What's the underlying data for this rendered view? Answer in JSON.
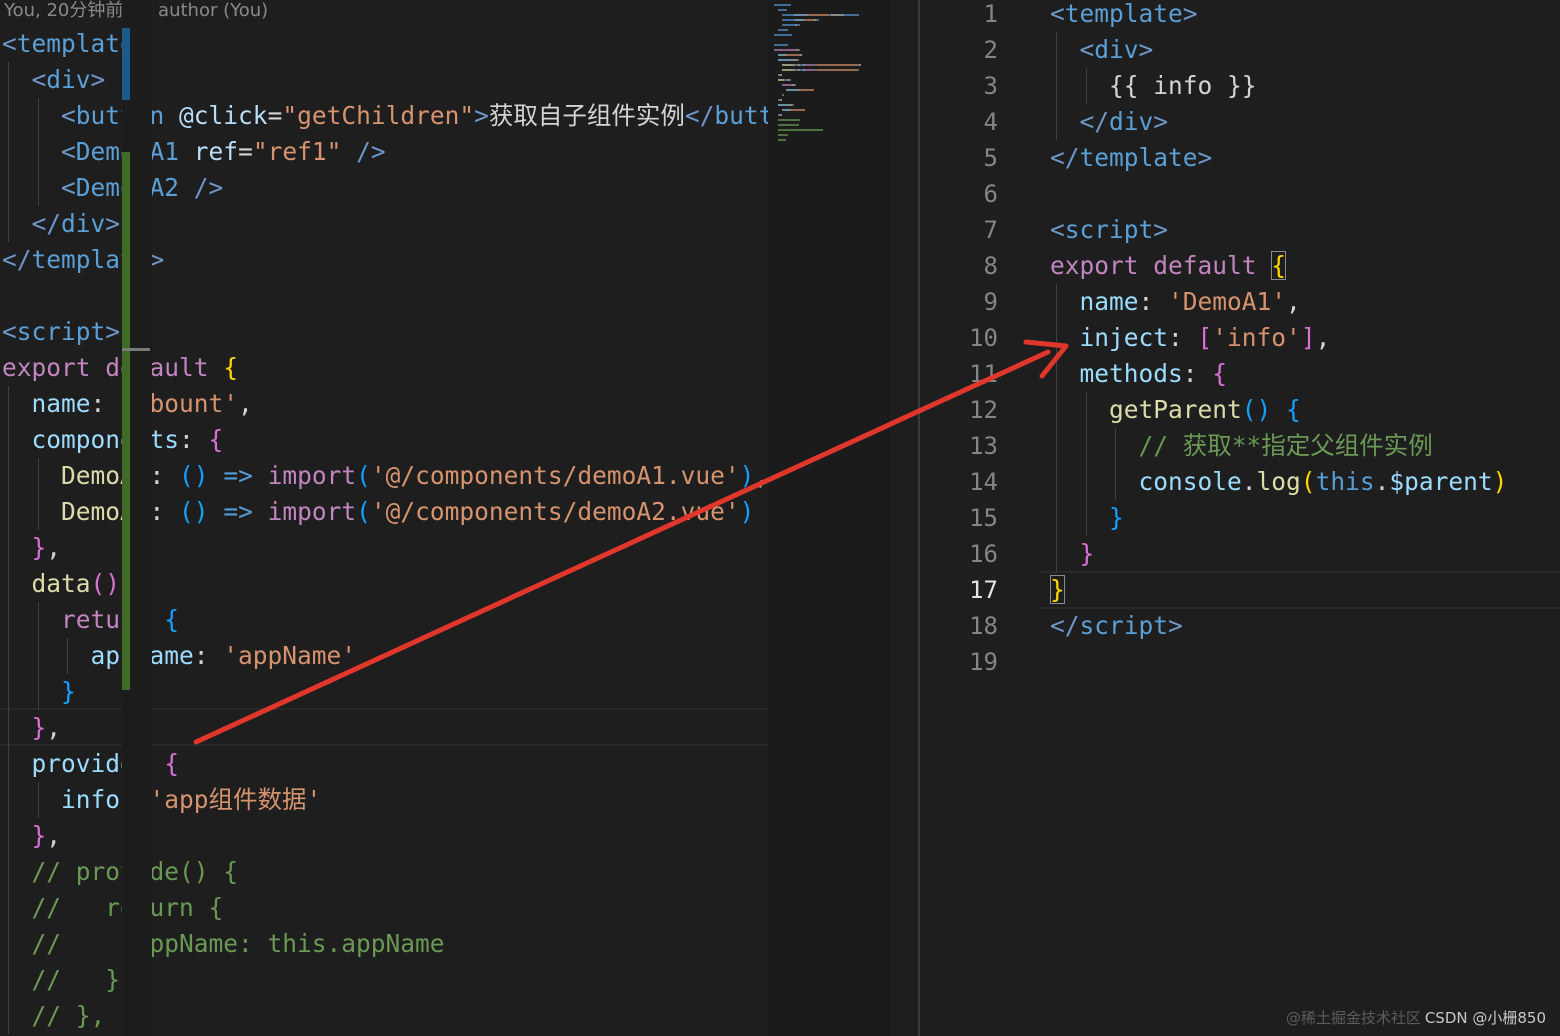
{
  "blame": "You, 20分钟前 | 1 author (You)",
  "left_code": [
    {
      "indent": 0,
      "tokens": [
        [
          "t-tag",
          "<"
        ],
        [
          "t-tagname",
          "template"
        ],
        [
          "t-tag",
          ">"
        ]
      ]
    },
    {
      "indent": 1,
      "tokens": [
        [
          "t-tag",
          "<"
        ],
        [
          "t-tagname",
          "div"
        ],
        [
          "t-tag",
          ">"
        ]
      ]
    },
    {
      "indent": 2,
      "tokens": [
        [
          "t-tag",
          "<"
        ],
        [
          "t-tagname",
          "button"
        ],
        [
          "t-text",
          " "
        ],
        [
          "t-attr",
          "@click"
        ],
        [
          "t-text",
          "="
        ],
        [
          "t-str",
          "\"getChildren\""
        ],
        [
          "t-tag",
          ">"
        ],
        [
          "t-text",
          "获取自子组件实例"
        ],
        [
          "t-tag",
          "</"
        ],
        [
          "t-tagname",
          "button"
        ],
        [
          "t-tag",
          ">"
        ]
      ]
    },
    {
      "indent": 2,
      "tokens": [
        [
          "t-tag",
          "<"
        ],
        [
          "t-tagname",
          "Demo-A1"
        ],
        [
          "t-text",
          " "
        ],
        [
          "t-attr",
          "ref"
        ],
        [
          "t-text",
          "="
        ],
        [
          "t-str",
          "\"ref1\""
        ],
        [
          "t-text",
          " "
        ],
        [
          "t-tag",
          "/>"
        ]
      ]
    },
    {
      "indent": 2,
      "tokens": [
        [
          "t-tag",
          "<"
        ],
        [
          "t-tagname",
          "Demo-A2"
        ],
        [
          "t-text",
          " "
        ],
        [
          "t-tag",
          "/>"
        ]
      ]
    },
    {
      "indent": 1,
      "tokens": [
        [
          "t-tag",
          "</"
        ],
        [
          "t-tagname",
          "div"
        ],
        [
          "t-tag",
          ">"
        ]
      ]
    },
    {
      "indent": 0,
      "tokens": [
        [
          "t-tag",
          "</"
        ],
        [
          "t-tagname",
          "template"
        ],
        [
          "t-tag",
          ">"
        ]
      ]
    },
    {
      "indent": 0,
      "tokens": []
    },
    {
      "indent": 0,
      "tokens": [
        [
          "t-tag",
          "<"
        ],
        [
          "t-tagname",
          "script"
        ],
        [
          "t-tag",
          ">"
        ]
      ]
    },
    {
      "indent": 0,
      "tokens": [
        [
          "t-kw",
          "export default"
        ],
        [
          "t-text",
          " "
        ],
        [
          "t-brace1",
          "{"
        ]
      ]
    },
    {
      "indent": 1,
      "tokens": [
        [
          "t-prop",
          "name"
        ],
        [
          "t-text",
          ": "
        ],
        [
          "t-str",
          "'abount'"
        ],
        [
          "t-text",
          ","
        ]
      ]
    },
    {
      "indent": 1,
      "tokens": [
        [
          "t-prop",
          "components"
        ],
        [
          "t-text",
          ": "
        ],
        [
          "t-brace2",
          "{"
        ]
      ]
    },
    {
      "indent": 2,
      "tokens": [
        [
          "t-fn",
          "DemoA1"
        ],
        [
          "t-text",
          ": "
        ],
        [
          "t-brace3",
          "()"
        ],
        [
          "t-text",
          " "
        ],
        [
          "t-this",
          "=>"
        ],
        [
          "t-text",
          " "
        ],
        [
          "t-kw",
          "import"
        ],
        [
          "t-brace3",
          "("
        ],
        [
          "t-str",
          "'@/components/demoA1.vue'"
        ],
        [
          "t-brace3",
          ")"
        ],
        [
          "t-text",
          ","
        ]
      ]
    },
    {
      "indent": 2,
      "tokens": [
        [
          "t-fn",
          "DemoA2"
        ],
        [
          "t-text",
          ": "
        ],
        [
          "t-brace3",
          "()"
        ],
        [
          "t-text",
          " "
        ],
        [
          "t-this",
          "=>"
        ],
        [
          "t-text",
          " "
        ],
        [
          "t-kw",
          "import"
        ],
        [
          "t-brace3",
          "("
        ],
        [
          "t-str",
          "'@/components/demoA2.vue'"
        ],
        [
          "t-brace3",
          ")"
        ]
      ]
    },
    {
      "indent": 1,
      "tokens": [
        [
          "t-brace2",
          "}"
        ],
        [
          "t-text",
          ","
        ]
      ]
    },
    {
      "indent": 1,
      "tokens": [
        [
          "t-fn",
          "data"
        ],
        [
          "t-brace2",
          "()"
        ],
        [
          "t-text",
          " "
        ],
        [
          "t-brace2",
          "{"
        ]
      ]
    },
    {
      "indent": 2,
      "tokens": [
        [
          "t-kw",
          "return"
        ],
        [
          "t-text",
          " "
        ],
        [
          "t-brace3",
          "{"
        ]
      ]
    },
    {
      "indent": 3,
      "tokens": [
        [
          "t-prop",
          "appName"
        ],
        [
          "t-text",
          ": "
        ],
        [
          "t-str",
          "'appName'"
        ]
      ]
    },
    {
      "indent": 2,
      "tokens": [
        [
          "t-brace3",
          "}"
        ]
      ]
    },
    {
      "indent": 1,
      "tokens": [
        [
          "t-brace2",
          "}"
        ],
        [
          "t-text",
          ","
        ]
      ]
    },
    {
      "indent": 1,
      "tokens": [
        [
          "t-prop",
          "provide"
        ],
        [
          "t-text",
          ": "
        ],
        [
          "t-brace2",
          "{"
        ]
      ]
    },
    {
      "indent": 2,
      "tokens": [
        [
          "t-prop",
          "info"
        ],
        [
          "t-text",
          ": "
        ],
        [
          "t-str",
          "'app组件数据'"
        ]
      ]
    },
    {
      "indent": 1,
      "tokens": [
        [
          "t-brace2",
          "}"
        ],
        [
          "t-text",
          ","
        ]
      ]
    },
    {
      "indent": 1,
      "tokens": [
        [
          "t-comment",
          "// provide() {"
        ]
      ]
    },
    {
      "indent": 1,
      "tokens": [
        [
          "t-comment",
          "//   return {"
        ]
      ]
    },
    {
      "indent": 1,
      "tokens": [
        [
          "t-comment",
          "//     appName: this.appName"
        ]
      ]
    },
    {
      "indent": 1,
      "tokens": [
        [
          "t-comment",
          "//   }"
        ]
      ]
    },
    {
      "indent": 1,
      "tokens": [
        [
          "t-comment",
          "// },"
        ]
      ]
    }
  ],
  "right_code": [
    {
      "ln": "1",
      "indent": 0,
      "tokens": [
        [
          "t-tag",
          "<"
        ],
        [
          "t-tagname",
          "template"
        ],
        [
          "t-tag",
          ">"
        ]
      ]
    },
    {
      "ln": "2",
      "indent": 1,
      "tokens": [
        [
          "t-tag",
          "<"
        ],
        [
          "t-tagname",
          "div"
        ],
        [
          "t-tag",
          ">"
        ]
      ]
    },
    {
      "ln": "3",
      "indent": 2,
      "tokens": [
        [
          "t-text",
          "{{ info }}"
        ]
      ]
    },
    {
      "ln": "4",
      "indent": 1,
      "tokens": [
        [
          "t-tag",
          "</"
        ],
        [
          "t-tagname",
          "div"
        ],
        [
          "t-tag",
          ">"
        ]
      ]
    },
    {
      "ln": "5",
      "indent": 0,
      "tokens": [
        [
          "t-tag",
          "</"
        ],
        [
          "t-tagname",
          "template"
        ],
        [
          "t-tag",
          ">"
        ]
      ]
    },
    {
      "ln": "6",
      "indent": 0,
      "tokens": []
    },
    {
      "ln": "7",
      "indent": 0,
      "tokens": [
        [
          "t-tag",
          "<"
        ],
        [
          "t-tagname",
          "script"
        ],
        [
          "t-tag",
          ">"
        ]
      ]
    },
    {
      "ln": "8",
      "indent": 0,
      "tokens": [
        [
          "t-kw",
          "export default"
        ],
        [
          "t-text",
          " "
        ],
        [
          "t-brace1 bracket-box",
          "{"
        ]
      ]
    },
    {
      "ln": "9",
      "indent": 1,
      "tokens": [
        [
          "t-prop",
          "name"
        ],
        [
          "t-text",
          ": "
        ],
        [
          "t-str",
          "'DemoA1'"
        ],
        [
          "t-text",
          ","
        ]
      ]
    },
    {
      "ln": "10",
      "indent": 1,
      "tokens": [
        [
          "t-prop",
          "inject"
        ],
        [
          "t-text",
          ": "
        ],
        [
          "t-brace2",
          "["
        ],
        [
          "t-str",
          "'info'"
        ],
        [
          "t-brace2",
          "]"
        ],
        [
          "t-text",
          ","
        ]
      ]
    },
    {
      "ln": "11",
      "indent": 1,
      "tokens": [
        [
          "t-prop",
          "methods"
        ],
        [
          "t-text",
          ": "
        ],
        [
          "t-brace2",
          "{"
        ]
      ]
    },
    {
      "ln": "12",
      "indent": 2,
      "tokens": [
        [
          "t-fn",
          "getParent"
        ],
        [
          "t-brace3",
          "()"
        ],
        [
          "t-text",
          " "
        ],
        [
          "t-brace3",
          "{"
        ]
      ]
    },
    {
      "ln": "13",
      "indent": 3,
      "tokens": [
        [
          "t-comment",
          "// 获取**指定父组件实例"
        ]
      ]
    },
    {
      "ln": "14",
      "indent": 3,
      "tokens": [
        [
          "t-var",
          "console"
        ],
        [
          "t-text",
          "."
        ],
        [
          "t-fn",
          "log"
        ],
        [
          "t-brace1",
          "("
        ],
        [
          "t-this",
          "this"
        ],
        [
          "t-text",
          "."
        ],
        [
          "t-var",
          "$parent"
        ],
        [
          "t-brace1",
          ")"
        ]
      ]
    },
    {
      "ln": "15",
      "indent": 2,
      "tokens": [
        [
          "t-brace3",
          "}"
        ]
      ]
    },
    {
      "ln": "16",
      "indent": 1,
      "tokens": [
        [
          "t-brace2",
          "}"
        ]
      ]
    },
    {
      "ln": "17",
      "indent": 0,
      "tokens": [
        [
          "t-brace1 bracket-box",
          "}"
        ]
      ]
    },
    {
      "ln": "18",
      "indent": 0,
      "tokens": [
        [
          "t-tag",
          "</"
        ],
        [
          "t-tagname",
          "script"
        ],
        [
          "t-tag",
          ">"
        ]
      ]
    },
    {
      "ln": "19",
      "indent": 0,
      "tokens": []
    }
  ],
  "active_line": "17",
  "watermark_faint": "@稀土掘金技术社区",
  "watermark": "CSDN @小栅850",
  "colors": {
    "arrow": "#e0362c",
    "background": "#1e1e1e",
    "minimap_git_added": "#3f6b26",
    "minimap_git_modified": "#1c5a8a"
  }
}
